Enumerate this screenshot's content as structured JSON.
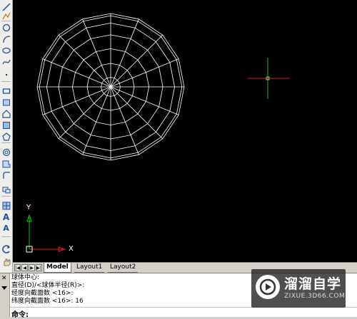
{
  "tabs": {
    "nav": [
      "|◀",
      "◀",
      "▶",
      "▶|"
    ],
    "model": "Model",
    "layout1": "Layout1",
    "layout2": "Layout2"
  },
  "ucs": {
    "x_label": "X",
    "y_label": "Y"
  },
  "command": {
    "lines": [
      "球体中心:",
      "直径(D)/<球体半径(R)>:",
      "经度向截面数 <16>:",
      "纬度向截面数 <16>: 16"
    ],
    "prompt": "命令:"
  },
  "watermark": {
    "title": "溜溜自学",
    "url": "ZIXUE.3D66.COM"
  },
  "colors": {
    "canvas": "#000000",
    "sphere": "#ffffff",
    "crosshair_h": "#cc2222",
    "crosshair_v": "#22bb22",
    "ucs_y": "#00cc00",
    "ucs_x": "#dd2222"
  }
}
